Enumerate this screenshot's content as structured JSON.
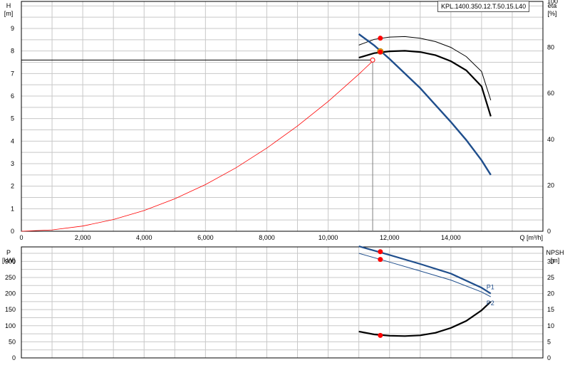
{
  "model_label": "KPL.1400.350.12.T.50.15.L40",
  "colors": {
    "grid": "#c8c8c8",
    "axis": "#000000",
    "pump_curve": "#1f4e8c",
    "system_curve": "#ff0000",
    "operating_point": "#ffd700",
    "marker": "#ff0000",
    "efficiency_curve": "#000000",
    "power_curve": "#1f4e8c",
    "npsh_curve": "#000000",
    "duty_line": "#000000",
    "duty_vertical": "#808080"
  },
  "chart_data": [
    {
      "type": "line",
      "xlabel": "Q [m³/h]",
      "x_ticks": [
        "0",
        "2,000",
        "4,000",
        "6,000",
        "8,000",
        "10,000",
        "12,000",
        "14,000"
      ],
      "xlim": [
        0,
        17000
      ],
      "ylabel_left": "H",
      "ylabel_left_unit": "[m]",
      "ylabel_right": "eta",
      "ylabel_right_unit": "[%]",
      "y_ticks_left": [
        "0",
        "1",
        "2",
        "3",
        "4",
        "5",
        "6",
        "7",
        "8",
        "9"
      ],
      "y_ticks_right": [
        "0",
        "20",
        "40",
        "60",
        "80",
        "100"
      ],
      "ylim_left": [
        0,
        10.2
      ],
      "ylim_right": [
        0,
        100
      ],
      "grid": true,
      "series": [
        {
          "role": "head",
          "axis": "left",
          "x": [
            11000,
            11500,
            12000,
            12500,
            13000,
            13500,
            14000,
            14500,
            15000,
            15300
          ],
          "y": [
            8.75,
            8.25,
            7.65,
            7.0,
            6.35,
            5.6,
            4.85,
            4.05,
            3.15,
            2.5
          ]
        },
        {
          "role": "system",
          "axis": "left",
          "x": [
            0,
            1000,
            2000,
            3000,
            4000,
            5000,
            6000,
            7000,
            8000,
            9000,
            10000,
            11000,
            11450
          ],
          "y": [
            0,
            0.06,
            0.23,
            0.52,
            0.92,
            1.44,
            2.07,
            2.82,
            3.69,
            4.67,
            5.76,
            6.97,
            7.55
          ]
        },
        {
          "role": "efficiency_1",
          "axis": "right",
          "x": [
            11000,
            11500,
            12000,
            12500,
            13000,
            13500,
            14000,
            14500,
            15000,
            15300
          ],
          "y": [
            81,
            83.5,
            84.5,
            84.7,
            84,
            82.5,
            80,
            76,
            69.5,
            57
          ]
        },
        {
          "role": "efficiency_2",
          "axis": "right",
          "x": [
            11000,
            11500,
            12000,
            12500,
            13000,
            13500,
            14000,
            14500,
            15000,
            15300
          ],
          "y": [
            75.5,
            77.5,
            78.3,
            78.5,
            78,
            76.6,
            74,
            70,
            63,
            50
          ]
        }
      ],
      "duty_point": {
        "Q": 11450,
        "H": 7.6
      },
      "operating_point": {
        "Q": 11700,
        "H": 7.98
      },
      "markers": [
        {
          "axis": "right",
          "Q": 11700,
          "value": 84
        },
        {
          "axis": "right",
          "Q": 11700,
          "value": 78
        }
      ]
    },
    {
      "type": "line",
      "ylabel_left": "P",
      "ylabel_left_unit": "[kW]",
      "ylabel_right": "NPSH",
      "ylabel_right_unit": "[m]",
      "y_ticks_left": [
        "0",
        "50",
        "100",
        "150",
        "200",
        "250",
        "300"
      ],
      "y_ticks_right": [
        "0",
        "5",
        "10",
        "15",
        "20",
        "25",
        "30"
      ],
      "ylim_left": [
        0,
        345
      ],
      "ylim_right": [
        0,
        34.5
      ],
      "xlim": [
        0,
        17000
      ],
      "grid": true,
      "series": [
        {
          "name": "P1",
          "role": "power",
          "axis": "left",
          "x": [
            11000,
            12000,
            13000,
            14000,
            15000,
            15300
          ],
          "y": [
            347,
            320,
            292,
            262,
            218,
            200
          ]
        },
        {
          "name": "P2",
          "role": "power",
          "axis": "left",
          "x": [
            11000,
            12000,
            13000,
            14000,
            15000,
            15300
          ],
          "y": [
            325,
            298,
            270,
            242,
            205,
            190
          ]
        },
        {
          "role": "npsh",
          "axis": "right",
          "x": [
            11000,
            11500,
            12000,
            12500,
            13000,
            13500,
            14000,
            14500,
            15000,
            15300
          ],
          "y": [
            8.2,
            7.3,
            6.9,
            6.8,
            7.0,
            7.8,
            9.3,
            11.5,
            14.8,
            17.5
          ]
        }
      ],
      "markers": [
        {
          "axis": "left",
          "Q": 11700,
          "value": 330
        },
        {
          "axis": "left",
          "Q": 11700,
          "value": 306
        },
        {
          "axis": "right",
          "Q": 11700,
          "value": 7.0
        }
      ]
    }
  ]
}
